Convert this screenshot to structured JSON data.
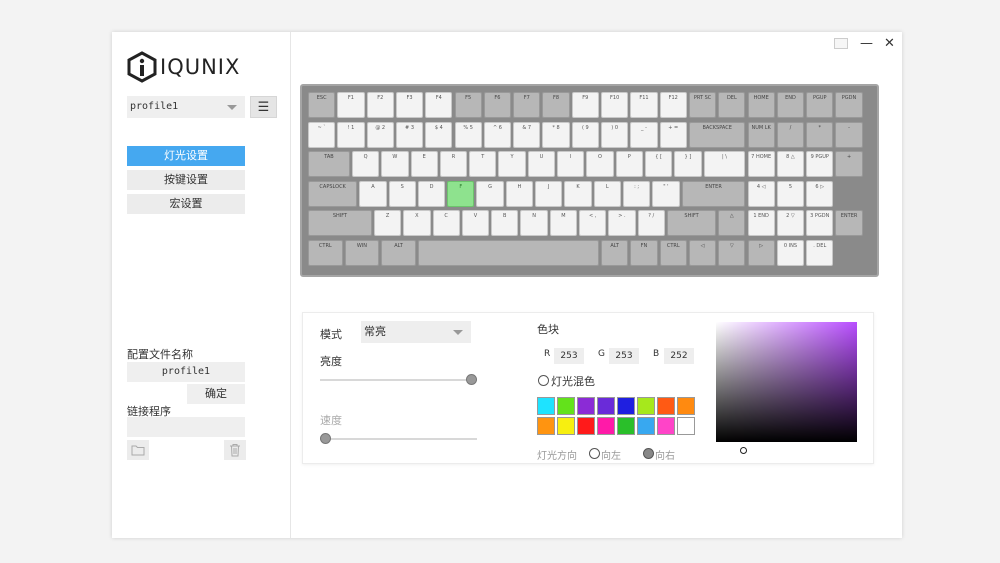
{
  "brand": {
    "name": "IQUNIX"
  },
  "window_controls": {
    "minimize": "—",
    "close": "✕"
  },
  "sidebar": {
    "profile_select": "profile1",
    "menu_icon": "☰",
    "nav": [
      {
        "label": "灯光设置",
        "active": true
      },
      {
        "label": "按键设置",
        "active": false
      },
      {
        "label": "宏设置",
        "active": false
      }
    ],
    "profile_name_label": "配置文件名称",
    "profile_name_value": "profile1",
    "confirm_label": "确定",
    "link_program_label": "链接程序"
  },
  "keyboard": {
    "rows": [
      [
        {
          "t": "ESC",
          "c": "g",
          "w": 1
        },
        {
          "t": "F1",
          "c": "w",
          "w": 1
        },
        {
          "t": "F2",
          "c": "w",
          "w": 1
        },
        {
          "t": "F3",
          "c": "w",
          "w": 1
        },
        {
          "t": "F4",
          "c": "w",
          "w": 1
        },
        {
          "t": "F5",
          "c": "g",
          "w": 1
        },
        {
          "t": "F6",
          "c": "g",
          "w": 1
        },
        {
          "t": "F7",
          "c": "g",
          "w": 1
        },
        {
          "t": "F8",
          "c": "g",
          "w": 1
        },
        {
          "t": "F9",
          "c": "w",
          "w": 1
        },
        {
          "t": "F10",
          "c": "w",
          "w": 1
        },
        {
          "t": "F11",
          "c": "w",
          "w": 1
        },
        {
          "t": "F12",
          "c": "w",
          "w": 1
        },
        {
          "t": "PRT SC",
          "c": "g",
          "w": 1
        },
        {
          "t": "DEL",
          "c": "g",
          "w": 1
        },
        {
          "t": "HOME",
          "c": "g",
          "w": 1
        },
        {
          "t": "END",
          "c": "g",
          "w": 1
        },
        {
          "t": "PGUP",
          "c": "g",
          "w": 1
        },
        {
          "t": "PGDN",
          "c": "g",
          "w": 1
        }
      ],
      [
        {
          "t": "~ `",
          "c": "w",
          "w": 1
        },
        {
          "t": "! 1",
          "c": "w",
          "w": 1
        },
        {
          "t": "@ 2",
          "c": "w",
          "w": 1
        },
        {
          "t": "# 3",
          "c": "w",
          "w": 1
        },
        {
          "t": "$ 4",
          "c": "w",
          "w": 1
        },
        {
          "t": "% 5",
          "c": "w",
          "w": 1
        },
        {
          "t": "^ 6",
          "c": "w",
          "w": 1
        },
        {
          "t": "& 7",
          "c": "w",
          "w": 1
        },
        {
          "t": "* 8",
          "c": "w",
          "w": 1
        },
        {
          "t": "( 9",
          "c": "w",
          "w": 1
        },
        {
          "t": ") 0",
          "c": "w",
          "w": 1
        },
        {
          "t": "_ -",
          "c": "w",
          "w": 1
        },
        {
          "t": "+ =",
          "c": "w",
          "w": 1
        },
        {
          "t": "BACKSPACE",
          "c": "g",
          "w": 2
        },
        {
          "t": "NUM LK",
          "c": "g",
          "w": 1
        },
        {
          "t": "/",
          "c": "g",
          "w": 1
        },
        {
          "t": "*",
          "c": "g",
          "w": 1
        },
        {
          "t": "-",
          "c": "g",
          "w": 1
        }
      ],
      [
        {
          "t": "TAB",
          "c": "g",
          "w": 1.5
        },
        {
          "t": "Q",
          "c": "w",
          "w": 1
        },
        {
          "t": "W",
          "c": "w",
          "w": 1
        },
        {
          "t": "E",
          "c": "w",
          "w": 1
        },
        {
          "t": "R",
          "c": "w",
          "w": 1
        },
        {
          "t": "T",
          "c": "w",
          "w": 1
        },
        {
          "t": "Y",
          "c": "w",
          "w": 1
        },
        {
          "t": "U",
          "c": "w",
          "w": 1
        },
        {
          "t": "I",
          "c": "w",
          "w": 1
        },
        {
          "t": "O",
          "c": "w",
          "w": 1
        },
        {
          "t": "P",
          "c": "w",
          "w": 1
        },
        {
          "t": "{ [",
          "c": "w",
          "w": 1
        },
        {
          "t": "} ]",
          "c": "w",
          "w": 1
        },
        {
          "t": "| \\",
          "c": "w",
          "w": 1.5
        },
        {
          "t": "7 HOME",
          "c": "w",
          "w": 1
        },
        {
          "t": "8 △",
          "c": "w",
          "w": 1
        },
        {
          "t": "9 PGUP",
          "c": "w",
          "w": 1
        },
        {
          "t": "+",
          "c": "g",
          "w": 1
        }
      ],
      [
        {
          "t": "CAPSLOCK",
          "c": "g",
          "w": 1.75
        },
        {
          "t": "A",
          "c": "w",
          "w": 1
        },
        {
          "t": "S",
          "c": "w",
          "w": 1
        },
        {
          "t": "D",
          "c": "w",
          "w": 1
        },
        {
          "t": "F",
          "c": "hl",
          "w": 1
        },
        {
          "t": "G",
          "c": "w",
          "w": 1
        },
        {
          "t": "H",
          "c": "w",
          "w": 1
        },
        {
          "t": "J",
          "c": "w",
          "w": 1
        },
        {
          "t": "K",
          "c": "w",
          "w": 1
        },
        {
          "t": "L",
          "c": "w",
          "w": 1
        },
        {
          "t": ": ;",
          "c": "w",
          "w": 1
        },
        {
          "t": "\" '",
          "c": "w",
          "w": 1
        },
        {
          "t": "ENTER",
          "c": "g",
          "w": 2.25
        },
        {
          "t": "4 ◁",
          "c": "w",
          "w": 1
        },
        {
          "t": "5",
          "c": "w",
          "w": 1
        },
        {
          "t": "6 ▷",
          "c": "w",
          "w": 1
        }
      ],
      [
        {
          "t": "SHIFT",
          "c": "g",
          "w": 2.25
        },
        {
          "t": "Z",
          "c": "w",
          "w": 1
        },
        {
          "t": "X",
          "c": "w",
          "w": 1
        },
        {
          "t": "C",
          "c": "w",
          "w": 1
        },
        {
          "t": "V",
          "c": "w",
          "w": 1
        },
        {
          "t": "B",
          "c": "w",
          "w": 1
        },
        {
          "t": "N",
          "c": "w",
          "w": 1
        },
        {
          "t": "M",
          "c": "w",
          "w": 1
        },
        {
          "t": "< ,",
          "c": "w",
          "w": 1
        },
        {
          "t": "> .",
          "c": "w",
          "w": 1
        },
        {
          "t": "? /",
          "c": "w",
          "w": 1
        },
        {
          "t": "SHIFT",
          "c": "g",
          "w": 1.75
        },
        {
          "t": "△",
          "c": "g",
          "w": 1
        },
        {
          "t": "1 END",
          "c": "w",
          "w": 1
        },
        {
          "t": "2 ▽",
          "c": "w",
          "w": 1
        },
        {
          "t": "3 PGDN",
          "c": "w",
          "w": 1
        },
        {
          "t": "ENTER",
          "c": "g",
          "w": 1
        }
      ],
      [
        {
          "t": "CTRL",
          "c": "g",
          "w": 1.25
        },
        {
          "t": "WIN",
          "c": "g",
          "w": 1.25
        },
        {
          "t": "ALT",
          "c": "g",
          "w": 1.25
        },
        {
          "t": "",
          "c": "g",
          "w": 6.25
        },
        {
          "t": "ALT",
          "c": "g",
          "w": 1
        },
        {
          "t": "FN",
          "c": "g",
          "w": 1
        },
        {
          "t": "CTRL",
          "c": "g",
          "w": 1
        },
        {
          "t": "◁",
          "c": "g",
          "w": 1
        },
        {
          "t": "▽",
          "c": "g",
          "w": 1
        },
        {
          "t": "▷",
          "c": "g",
          "w": 1
        },
        {
          "t": "0 INS",
          "c": "w",
          "w": 1
        },
        {
          "t": ". DEL",
          "c": "w",
          "w": 1
        }
      ]
    ]
  },
  "lighting": {
    "mode_label": "模式",
    "mode_value": "常亮",
    "brightness_label": "亮度",
    "brightness_level": 1.0,
    "speed_label": "速度",
    "speed_level": 0.0,
    "color_block_label": "色块",
    "r_label": "R",
    "r_value": "253",
    "g_label": "G",
    "g_value": "253",
    "b_label": "B",
    "b_value": "252",
    "mix_label": "灯光混色",
    "direction_label": "灯光方向",
    "dir_left_label": "向左",
    "dir_right_label": "向右",
    "swatches": [
      "#1ee3ff",
      "#63e21b",
      "#8b2bd6",
      "#6a2bd9",
      "#1f1fe0",
      "#a6e81c",
      "#ff5a14",
      "#ff8a10",
      "#ff9410",
      "#f7ef10",
      "#ff1a1a",
      "#ff1aa8",
      "#2abf2a",
      "#38a8f0",
      "#ff44c8",
      "#ffffff"
    ]
  }
}
